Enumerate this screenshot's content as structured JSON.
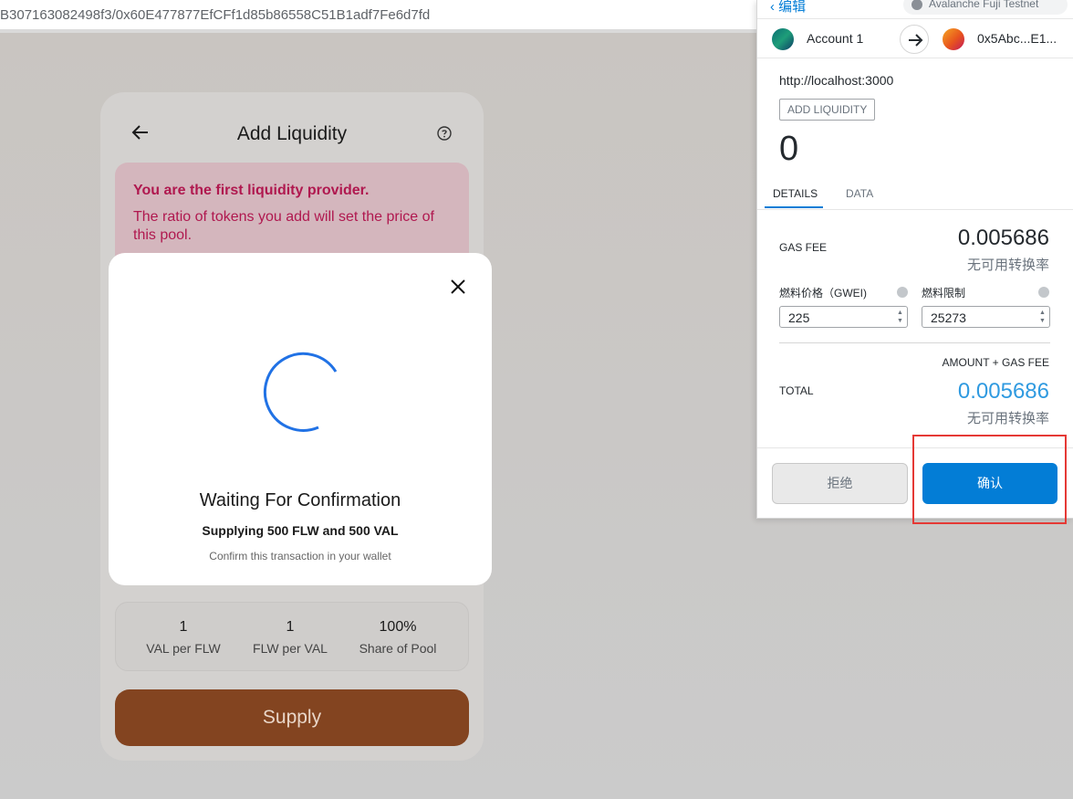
{
  "browser": {
    "url": "B307163082498f3/0x60E477877EfCFf1d85b86558C51B1adf7Fe6d7fd"
  },
  "card": {
    "title": "Add Liquidity",
    "notice_heading": "You are the first liquidity provider.",
    "notice_body": "The ratio of tokens you add will set the price of this pool.",
    "stats": [
      {
        "value": "1",
        "label": "VAL per FLW"
      },
      {
        "value": "1",
        "label": "FLW per VAL"
      },
      {
        "value": "100%",
        "label": "Share of Pool"
      }
    ],
    "supply_label": "Supply"
  },
  "modal": {
    "title": "Waiting For Confirmation",
    "subtitle": "Supplying 500 FLW and 500 VAL",
    "hint": "Confirm this transaction in your wallet"
  },
  "metamask": {
    "edit_label": "编辑",
    "network": "Avalanche Fuji Testnet",
    "from_account": "Account 1",
    "to_account": "0x5Abc...E1...",
    "origin": "http://localhost:3000",
    "method": "ADD LIQUIDITY",
    "amount": "0",
    "tabs": [
      "DETAILS",
      "DATA"
    ],
    "gas_fee_label": "GAS FEE",
    "gas_fee_value": "0.005686",
    "gas_fee_conversion": "无可用转换率",
    "gas_price_label": "燃料价格（GWEI)",
    "gas_limit_label": "燃料限制",
    "gas_price_value": "225",
    "gas_limit_value": "25273",
    "amount_gas_fee_label": "AMOUNT + GAS FEE",
    "total_label": "TOTAL",
    "total_value": "0.005686",
    "total_conversion": "无可用转换率",
    "reject_label": "拒绝",
    "confirm_label": "确认",
    "colors": {
      "accent": "#037dd6",
      "total": "#2f9ae0"
    }
  },
  "highlight": {
    "color": "#e53935"
  }
}
